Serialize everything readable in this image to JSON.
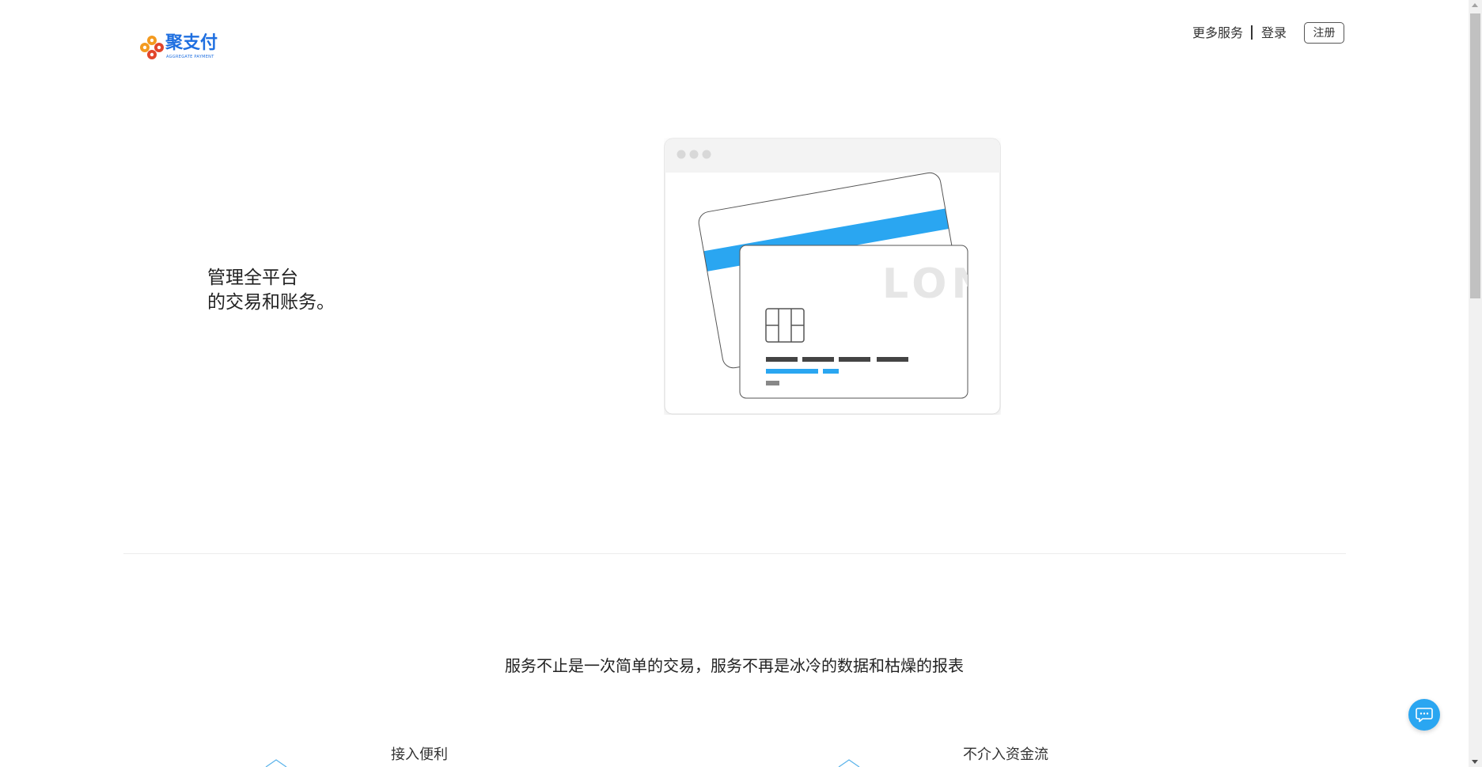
{
  "header": {
    "logo_text": "聚支付",
    "logo_subtext": "AGGREGATE PAYMENT",
    "nav": {
      "more_services": "更多服务",
      "login": "登录",
      "register": "注册"
    }
  },
  "hero": {
    "line1": "管理全平台",
    "line2": "的交易和账务。",
    "illustration": {
      "card_brand_text": "LON"
    }
  },
  "slogan": "服务不止是一次简单的交易，服务不再是冰冷的数据和枯燥的报表",
  "features": [
    {
      "title": "接入便利",
      "icon": "feature-icon"
    },
    {
      "title": "不介入资金流",
      "icon": "feature-icon"
    }
  ],
  "colors": {
    "accent_blue": "#2aa6f1",
    "logo_blue": "#1f6fe0",
    "logo_orange": "#f39a1f",
    "logo_red": "#e2452b"
  },
  "icons": {
    "chat": "chat-bubble-icon"
  }
}
